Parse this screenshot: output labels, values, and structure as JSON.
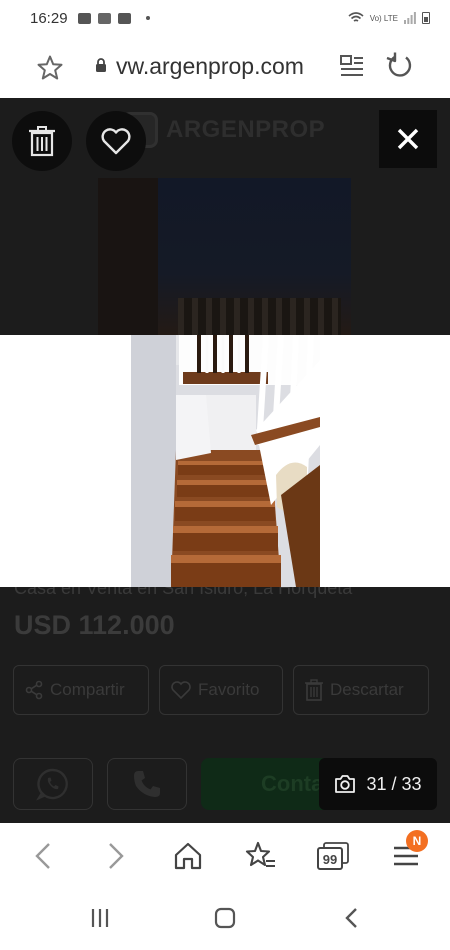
{
  "status_bar": {
    "time": "16:29",
    "network_label": "Vo) LTE"
  },
  "browser": {
    "url": "vw.argenprop.com"
  },
  "page": {
    "logo_text": "ARGENPROP",
    "listing_title": "Casa en Venta en San Isidro, La Horqueta",
    "price": "USD 112.000",
    "actions": [
      {
        "label": "Compartir",
        "icon": "share-icon"
      },
      {
        "label": "Favorito",
        "icon": "heart-outline-icon"
      },
      {
        "label": "Descartar",
        "icon": "trash-icon"
      }
    ],
    "contact_label": "Contactar"
  },
  "gallery": {
    "counter": "31 / 33"
  },
  "browser_toolbar": {
    "tabs_count": "99",
    "menu_badge": "N"
  },
  "colors": {
    "badge": "#f36f21",
    "overlay": "#1c1c1c"
  }
}
